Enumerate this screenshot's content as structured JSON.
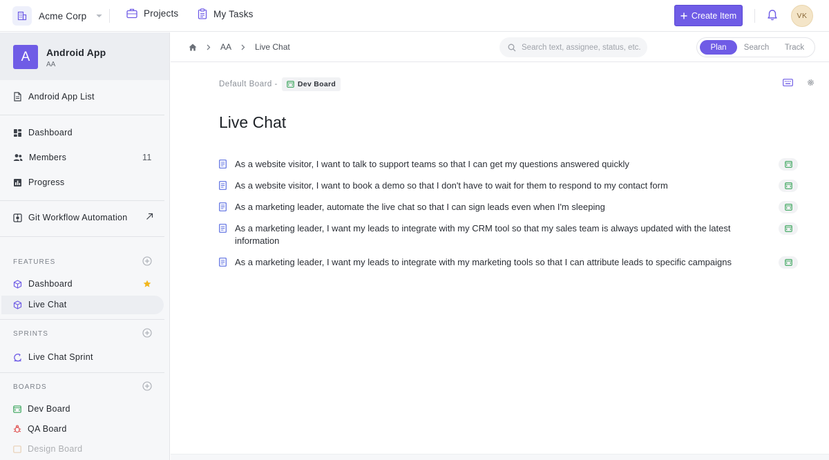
{
  "colors": {
    "accent": "#6f5ce6",
    "board_green": "#3aa55b",
    "board_red": "#e05050",
    "star": "#f2b61c"
  },
  "topbar": {
    "org_name": "Acme Corp",
    "nav": [
      {
        "label": "Projects",
        "icon": "briefcase-icon"
      },
      {
        "label": "My Tasks",
        "icon": "clipboard-icon"
      }
    ],
    "create_label": "Create Item",
    "avatar_initials": "VK"
  },
  "sidebar": {
    "project": {
      "initial": "A",
      "name": "Android App",
      "key": "AA"
    },
    "list_label": "Android App List",
    "nav": [
      {
        "label": "Dashboard",
        "icon": "dashboard-icon"
      },
      {
        "label": "Members",
        "count": "11",
        "icon": "members-icon"
      },
      {
        "label": "Progress",
        "icon": "progress-icon"
      }
    ],
    "git_label": "Git Workflow Automation",
    "features_header": "FEATURES",
    "features": [
      {
        "label": "Dashboard",
        "starred": true
      },
      {
        "label": "Live Chat",
        "active": true
      }
    ],
    "sprints_header": "SPRINTS",
    "sprints": [
      {
        "label": "Live Chat Sprint"
      }
    ],
    "boards_header": "BOARDS",
    "boards": [
      {
        "label": "Dev Board"
      },
      {
        "label": "QA Board"
      },
      {
        "label": "Design Board"
      }
    ]
  },
  "breadcrumb": {
    "items": [
      "AA",
      "Live Chat"
    ]
  },
  "search": {
    "placeholder": "Search text, assignee, status, etc."
  },
  "modes": [
    "Plan",
    "Search",
    "Track"
  ],
  "active_mode": "Plan",
  "main": {
    "board_prefix": "Default Board -",
    "board_name": "Dev Board",
    "title": "Live Chat",
    "stories": [
      "As a website visitor, I want to talk to support teams so that I can get my questions answered quickly",
      "As a website visitor, I want to book a demo so that I don't have to wait for them to respond to my contact form",
      "As a marketing leader, automate the live chat so that I can sign leads even when I'm sleeping",
      "As a marketing leader, I want my leads to integrate with my CRM tool so that my sales team is always updated with the latest information",
      "As a marketing leader, I want my leads to integrate with my marketing tools so that I can attribute leads to specific campaigns"
    ]
  }
}
